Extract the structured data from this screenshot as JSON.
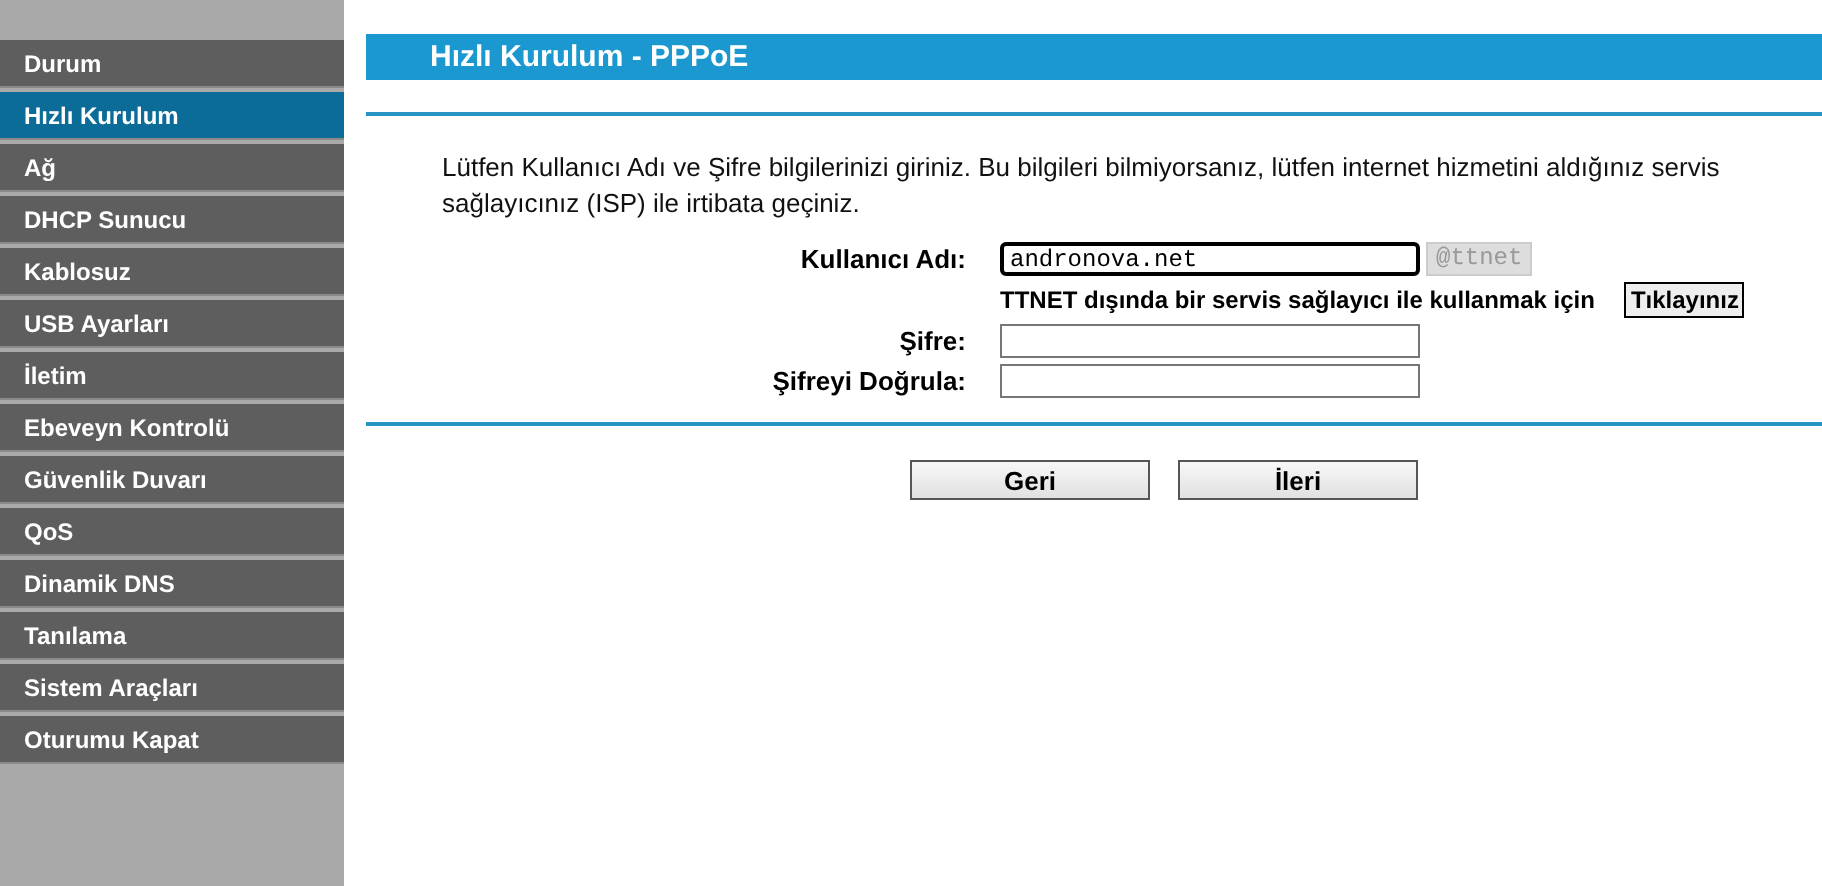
{
  "sidebar": {
    "items": [
      {
        "label": "Durum",
        "selected": false
      },
      {
        "label": "Hızlı Kurulum",
        "selected": true
      },
      {
        "label": "Ağ",
        "selected": false
      },
      {
        "label": "DHCP Sunucu",
        "selected": false
      },
      {
        "label": "Kablosuz",
        "selected": false
      },
      {
        "label": "USB Ayarları",
        "selected": false
      },
      {
        "label": "İletim",
        "selected": false
      },
      {
        "label": "Ebeveyn Kontrolü",
        "selected": false
      },
      {
        "label": "Güvenlik Duvarı",
        "selected": false
      },
      {
        "label": "QoS",
        "selected": false
      },
      {
        "label": "Dinamik DNS",
        "selected": false
      },
      {
        "label": "Tanılama",
        "selected": false
      },
      {
        "label": "Sistem Araçları",
        "selected": false
      },
      {
        "label": "Oturumu Kapat",
        "selected": false
      }
    ]
  },
  "page": {
    "title": "Hızlı Kurulum - PPPoE",
    "intro": "Lütfen Kullanıcı Adı ve Şifre bilgilerinizi giriniz. Bu bilgileri bilmiyorsanız, lütfen internet hizmetini aldığınız servis sağlayıcınız (ISP) ile irtibata geçiniz.",
    "username": {
      "label": "Kullanıcı Adı:",
      "value": "andronova.net",
      "suffix": "@ttnet"
    },
    "isp_note": "TTNET dışında bir servis sağlayıcı ile kullanmak için",
    "isp_button": "Tıklayınız",
    "password": {
      "label": "Şifre:"
    },
    "confirm": {
      "label": "Şifreyi Doğrula:"
    },
    "buttons": [
      "Geri",
      "İleri"
    ]
  }
}
